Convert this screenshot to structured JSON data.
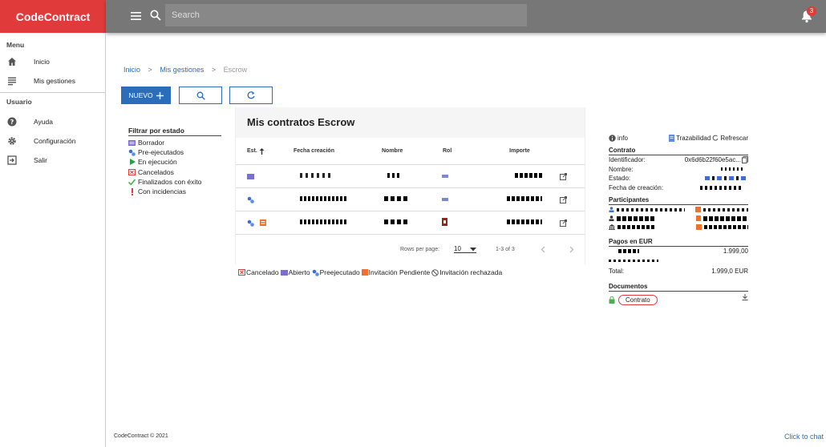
{
  "brand": "CodeContract",
  "header": {
    "search_placeholder": "Search",
    "notification_count": "3",
    "menu_icon": "hamburger-icon",
    "search_icon": "search-icon",
    "bell_icon": "bell-icon"
  },
  "sidebar": {
    "menu_section": "Menu",
    "usuario_section": "Usuario",
    "menu_items": [
      {
        "label": "Inicio",
        "icon": "home-icon"
      },
      {
        "label": "Mis gestiones",
        "icon": "list-icon"
      }
    ],
    "user_items": [
      {
        "label": "Ayuda",
        "icon": "help-icon"
      },
      {
        "label": "Configuración",
        "icon": "gear-icon"
      },
      {
        "label": "Salir",
        "icon": "logout-icon"
      }
    ]
  },
  "breadcrumb": {
    "home": "Inicio",
    "section": "Mis gestiones",
    "current": "Escrow",
    "separator": ">"
  },
  "toolbar": {
    "new_label": "NUEVO"
  },
  "filter": {
    "title": "Filtrar por estado",
    "items": [
      "Borrador",
      "Pre-ejecutados",
      "En ejecución",
      "Cancelados",
      "Finalizados con éxito",
      "Con incidencias"
    ]
  },
  "table": {
    "title": "Mis contratos Escrow",
    "columns": {
      "est": "Est.",
      "fecha": "Fecha creación",
      "nombre": "Nombre",
      "rol": "Rol",
      "importe": "Importe"
    },
    "rows_per_page_label": "Rows per page:",
    "rows_per_page": "10",
    "range": "1-3 of 3"
  },
  "legend": [
    "Cancelado",
    "Abierto",
    "Preejecutado",
    "Invitación Pendiente",
    "Invitación rechazada"
  ],
  "detail": {
    "info": "info",
    "trazabilidad": "Trazabilidad",
    "refrescar": "Refrescar",
    "contrato_title": "Contrato",
    "identificador_label": "Identificador:",
    "identificador_value": "0x6d6b22f60e5ac...",
    "nombre_label": "Nombre:",
    "estado_label": "Estado:",
    "fecha_label": "Fecha de creación:",
    "participantes_title": "Participantes",
    "pagos_title": "Pagos en EUR",
    "pago_value": "1.999,00",
    "total_label": "Total:",
    "total_value": "1.999,0 EUR",
    "documentos_title": "Documentos",
    "contrato_doc": "Contrato"
  },
  "footer": "CodeContract © 2021",
  "chat": "Click to chat",
  "colors": {
    "brand": "#e03a3a",
    "accent": "#2a6ebb",
    "topbar": "#777777"
  }
}
